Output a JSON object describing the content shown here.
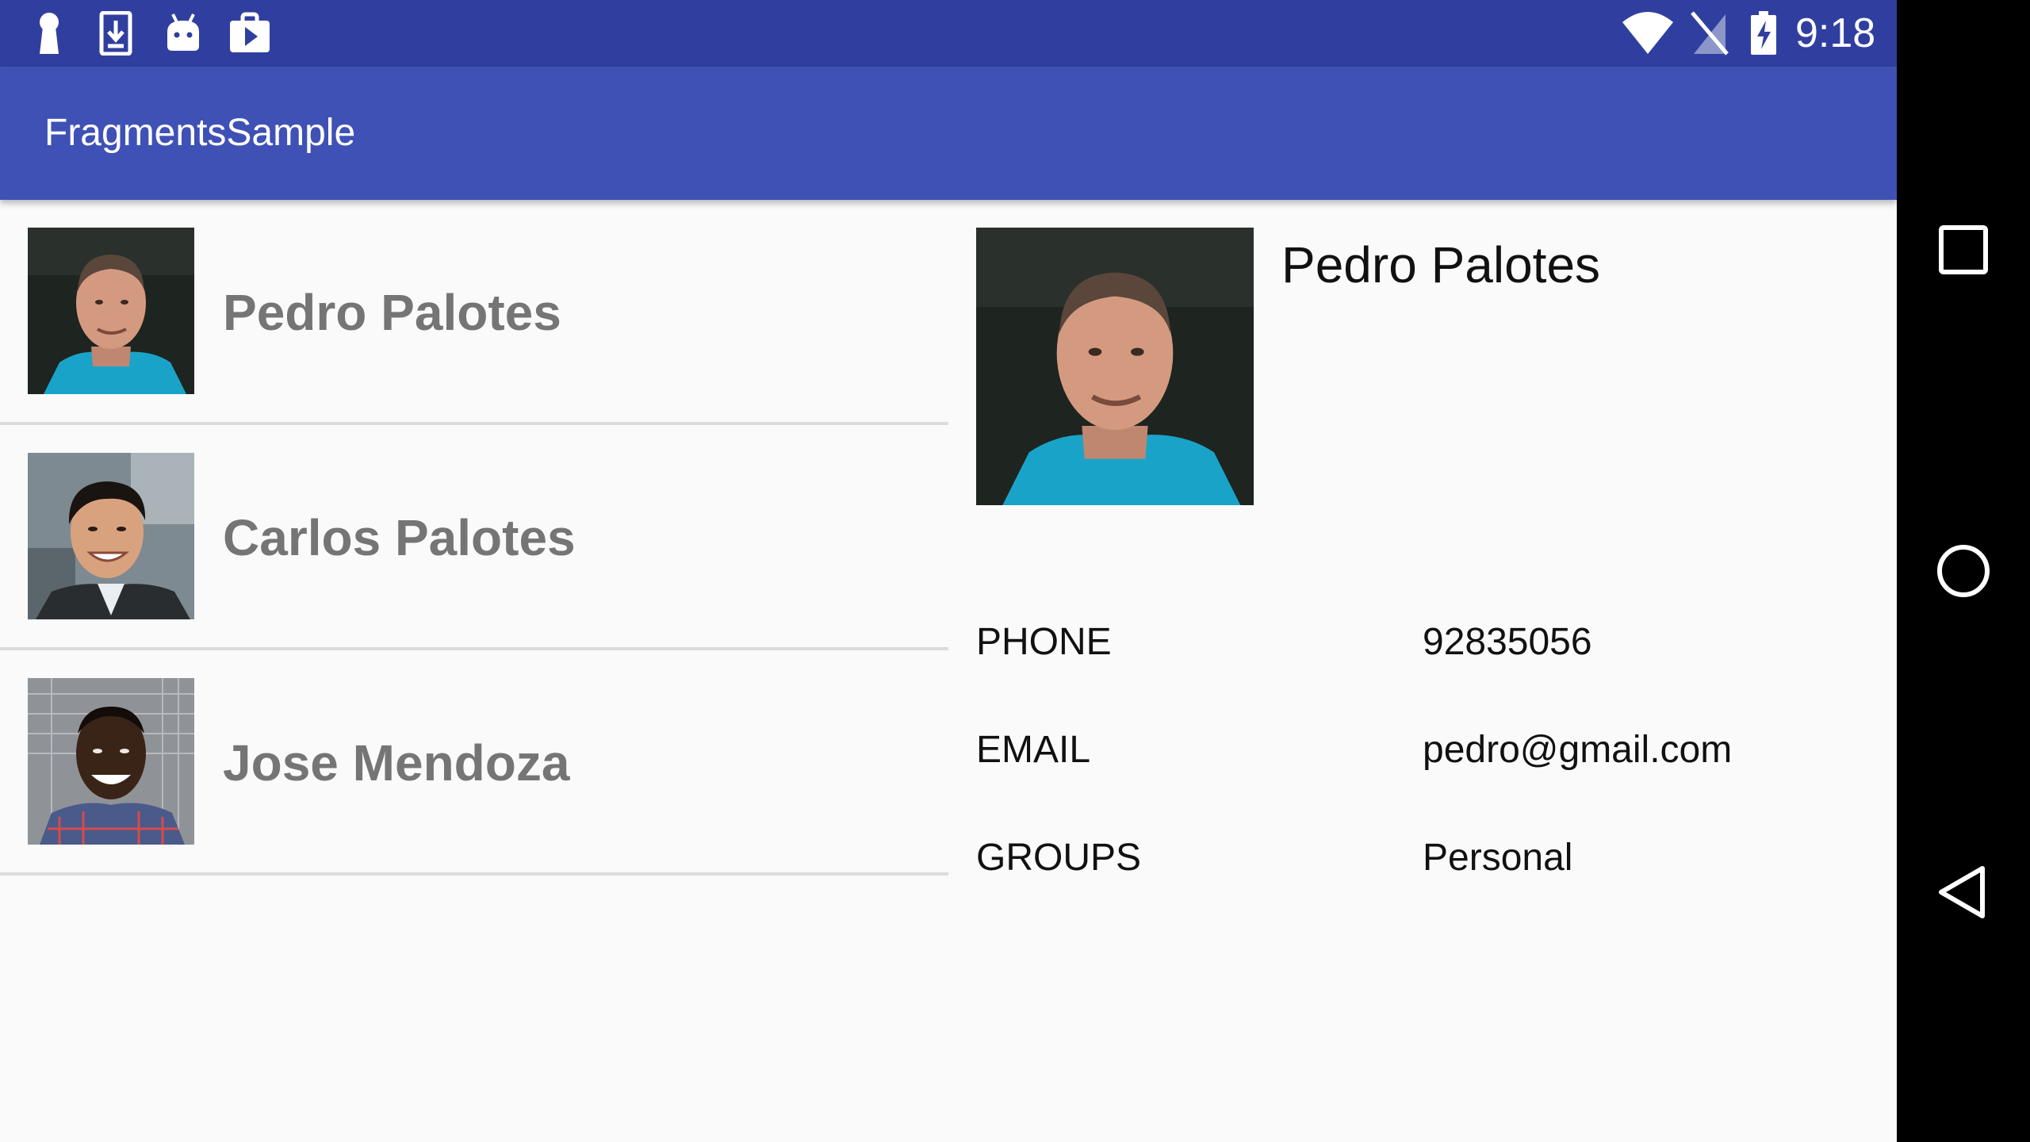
{
  "status_bar": {
    "time": "9:18",
    "left_icons": [
      "keyhole-icon",
      "download-icon",
      "android-icon",
      "play-store-icon"
    ],
    "right_icons": [
      "wifi-icon",
      "no-sim-icon",
      "battery-charging-icon"
    ]
  },
  "app_bar": {
    "title": "FragmentsSample",
    "color": "#3f51b5",
    "status_color": "#303f9f"
  },
  "contacts": [
    {
      "name": "Pedro Palotes"
    },
    {
      "name": "Carlos Palotes"
    },
    {
      "name": "Jose Mendoza"
    }
  ],
  "detail": {
    "name": "Pedro Palotes",
    "fields": [
      {
        "label": "PHONE",
        "value": "92835056"
      },
      {
        "label": "EMAIL",
        "value": "pedro@gmail.com"
      },
      {
        "label": "GROUPS",
        "value": "Personal"
      }
    ]
  },
  "nav_bar": {
    "buttons": [
      "recents-icon",
      "home-icon",
      "back-icon"
    ]
  }
}
